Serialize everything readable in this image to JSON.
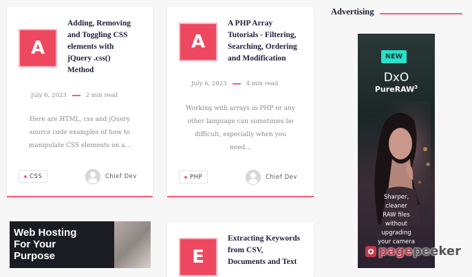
{
  "posts": [
    {
      "thumb_letter": "A",
      "title_lines": [
        "Adding, Removing",
        "and Toggling CSS",
        "elements with",
        "jQuery .css()",
        "Method"
      ],
      "date": "July 6, 2023",
      "read_time": "2 min read",
      "excerpt_lines": [
        "Here are HTML, css and jQuery",
        "source code examples of how to",
        "manipulate CSS elements on a..."
      ],
      "tag": "CSS",
      "author": "Chief Dev"
    },
    {
      "thumb_letter": "A",
      "title_lines": [
        "A PHP Array",
        "Tutorials - Filtering,",
        "Searching, Ordering",
        "and Modification"
      ],
      "date": "July 6, 2023",
      "read_time": "4 min read",
      "excerpt_lines": [
        "Working with arrays in PHP or any",
        "other language can sometimes be",
        "difficult, especially when you",
        "need..."
      ],
      "tag": "PHP",
      "author": "Chief Dev"
    },
    {
      "thumb_letter": "E",
      "title_lines": [
        "Extracting Keywords",
        "from CSV,",
        "Documents and Text"
      ]
    }
  ],
  "hosting_card": {
    "lines": [
      "Web Hosting",
      "For Your",
      "Purpose"
    ]
  },
  "sidebar": {
    "title": "Advertising",
    "ad": {
      "badge": "NEW",
      "brand": "DxO",
      "product": "PureRAW",
      "product_sup": "3",
      "tagline_lines": [
        "Sharper,",
        "cleaner",
        "RAW files",
        "without",
        "upgrading",
        "your camera"
      ]
    }
  },
  "watermark": {
    "text_a": "page",
    "text_b": "peeker"
  },
  "colors": {
    "accent": "#f25f75",
    "thumb": "#ee4860",
    "heading": "#1d1f3a",
    "ad_badge": "#2ae0c9"
  }
}
